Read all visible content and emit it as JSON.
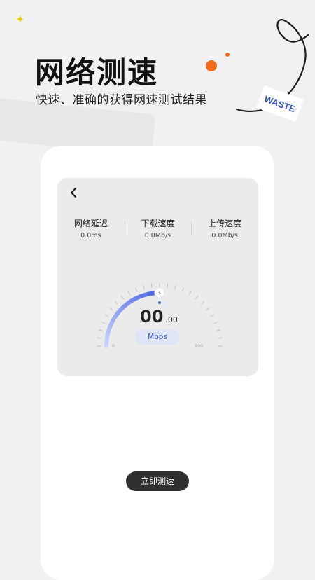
{
  "hero": {
    "title": "网络测速",
    "subtitle": "快速、准确的获得网速测试结果"
  },
  "decoration": {
    "tag_text": "WASTE",
    "sparkle": "✦",
    "accent_color": "#f26b1d",
    "tag_color": "#3a55c8"
  },
  "panel": {
    "back_icon": "chevron-left-icon",
    "stats": [
      {
        "label": "网络延迟",
        "value": "0.0ms"
      },
      {
        "label": "下载速度",
        "value": "0.0Mb/s"
      },
      {
        "label": "上传速度",
        "value": "0.0Mb/s"
      }
    ],
    "gauge": {
      "speed_integer": "00",
      "speed_decimal": ".00",
      "unit": "Mbps",
      "min_label": "0",
      "max_label": "999",
      "gradient_start": "#c9d3fb",
      "gradient_end": "#4a63e0",
      "level_fraction": 0.5
    }
  },
  "action": {
    "start_label": "立即测速"
  }
}
